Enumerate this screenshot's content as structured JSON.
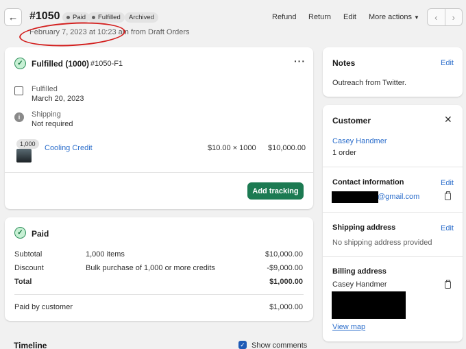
{
  "header": {
    "order_number": "#1050",
    "badges": [
      "Paid",
      "Fulfilled",
      "Archived"
    ],
    "subline": "February 7, 2023 at 10:23 am from Draft Orders",
    "actions": {
      "refund": "Refund",
      "return": "Return",
      "edit": "Edit",
      "more": "More actions"
    }
  },
  "fulfillment": {
    "title": "Fulfilled (1000)",
    "id": "#1050-F1",
    "fulfilled_label": "Fulfilled",
    "fulfilled_date": "March 20, 2023",
    "shipping_label": "Shipping",
    "shipping_value": "Not required",
    "item": {
      "qty_badge": "1,000",
      "name": "Cooling Credit",
      "unit": "$10.00 × 1000",
      "total": "$10,000.00"
    },
    "add_tracking": "Add tracking"
  },
  "payment": {
    "title": "Paid",
    "rows": [
      {
        "label": "Subtotal",
        "detail": "1,000 items",
        "amount": "$10,000.00"
      },
      {
        "label": "Discount",
        "detail": "Bulk purchase of 1,000 or more credits",
        "amount": "-$9,000.00"
      },
      {
        "label": "Total",
        "detail": "",
        "amount": "$1,000.00"
      }
    ],
    "paid_label": "Paid by customer",
    "paid_amount": "$1,000.00"
  },
  "timeline": {
    "title": "Timeline",
    "show_comments": "Show comments"
  },
  "notes": {
    "title": "Notes",
    "edit": "Edit",
    "text": "Outreach from Twitter."
  },
  "customer": {
    "title": "Customer",
    "name": "Casey Handmer",
    "orders": "1 order",
    "contact_title": "Contact information",
    "contact_edit": "Edit",
    "email_suffix": "@gmail.com",
    "shipping_title": "Shipping address",
    "shipping_edit": "Edit",
    "shipping_value": "No shipping address provided",
    "billing_title": "Billing address",
    "billing_name": "Casey Handmer",
    "view_map": "View map"
  }
}
